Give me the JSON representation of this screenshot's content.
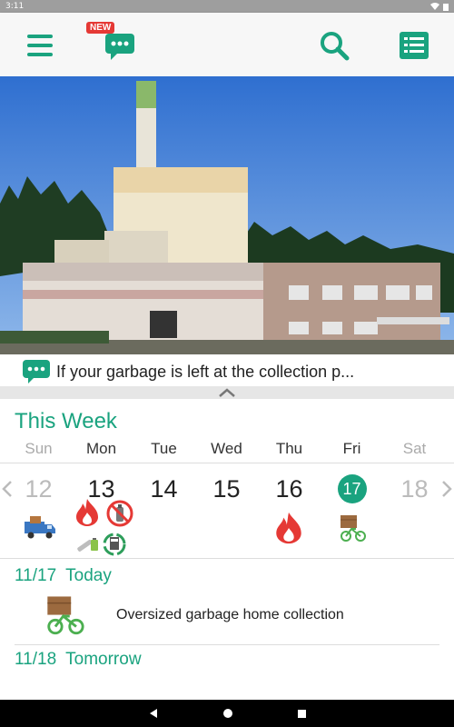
{
  "status_bar": {
    "time": "3:11"
  },
  "app_bar": {
    "new_badge": "NEW",
    "icons": [
      "menu-icon",
      "chat-bubble-icon",
      "search-icon",
      "list-icon"
    ]
  },
  "notice": {
    "text": "If your garbage is left at the collection p..."
  },
  "week": {
    "title": "This Week",
    "days": [
      {
        "dow": "Sun",
        "date": "12",
        "muted": true,
        "icons": [
          "truck-icon"
        ]
      },
      {
        "dow": "Mon",
        "date": "13",
        "muted": false,
        "icons": [
          "burnable-fire-icon",
          "no-spray-can-icon",
          "battery-icon",
          "recycle-icon"
        ]
      },
      {
        "dow": "Tue",
        "date": "14",
        "muted": false,
        "icons": []
      },
      {
        "dow": "Wed",
        "date": "15",
        "muted": false,
        "icons": []
      },
      {
        "dow": "Thu",
        "date": "16",
        "muted": false,
        "icons": [
          "burnable-fire-icon"
        ]
      },
      {
        "dow": "Fri",
        "date": "17",
        "muted": false,
        "today": true,
        "icons": [
          "oversized-box-bike-icon"
        ]
      },
      {
        "dow": "Sat",
        "date": "18",
        "muted": true,
        "icons": []
      }
    ]
  },
  "schedule": {
    "today": {
      "date": "11/17",
      "label": "Today",
      "item": "Oversized garbage home collection"
    },
    "tomorrow": {
      "date": "11/18",
      "label": "Tomorrow"
    }
  },
  "colors": {
    "accent": "#1aa37f",
    "badge": "#e53935",
    "fire": "#e53935"
  }
}
